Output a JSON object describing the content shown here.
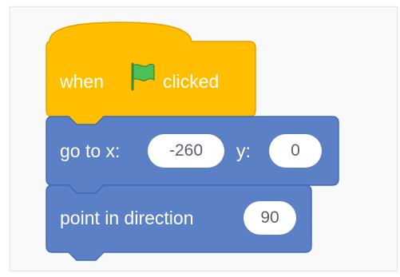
{
  "colors": {
    "events_block": "#FFBF00",
    "events_border": "#E6A000",
    "motion_block": "#4C97FF",
    "motion_block_image": "#5C80C6",
    "motion_border": "#3E6DB5",
    "input_text": "#575E75",
    "flag_green": "#4CBF56"
  },
  "blocks": [
    {
      "type": "hat",
      "text_before": "when",
      "icon": "green-flag-icon",
      "text_after": "clicked"
    },
    {
      "type": "stack",
      "label_x": "go to x:",
      "x_value": "-260",
      "label_y": "y:",
      "y_value": "0"
    },
    {
      "type": "stack",
      "label": "point in direction",
      "direction_value": "90"
    }
  ]
}
